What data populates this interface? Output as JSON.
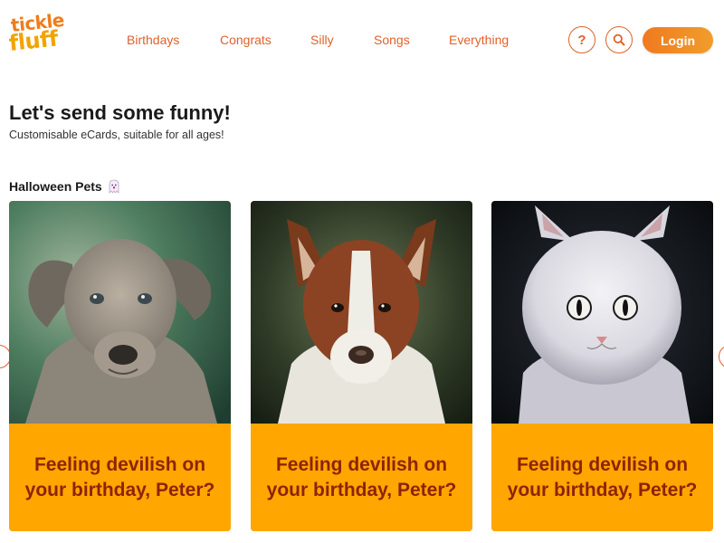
{
  "brand": {
    "logo_line1": "tickle",
    "logo_line2": "fluff"
  },
  "nav": {
    "items": [
      "Birthdays",
      "Congrats",
      "Silly",
      "Songs",
      "Everything"
    ]
  },
  "header_actions": {
    "help_label": "?",
    "login_label": "Login"
  },
  "hero": {
    "title": "Let's send some funny!",
    "subtitle": "Customisable eCards, suitable for all ages!"
  },
  "section": {
    "title": "Halloween Pets",
    "icon": "ghost-icon"
  },
  "cards": [
    {
      "image": "puppy-photo",
      "caption": "Feeling devilish on your birthday, Peter?"
    },
    {
      "image": "border-collie-photo",
      "caption": "Feeling devilish on your birthday, Peter?"
    },
    {
      "image": "white-cat-photo",
      "caption": "Feeling devilish on your birthday, Peter?"
    }
  ],
  "colors": {
    "accent": "#e0612a",
    "login_gradient_start": "#ef7a1f",
    "login_gradient_end": "#f19d2c",
    "card_background": "#ffa600",
    "card_text": "#8e2304"
  }
}
